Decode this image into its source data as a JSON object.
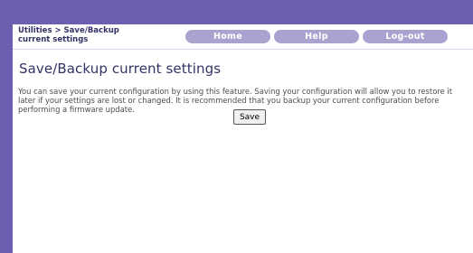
{
  "header": {
    "breadcrumb": "Utilities > Save/Backup current settings",
    "nav": {
      "home": "Home",
      "help": "Help",
      "logout": "Log-out"
    }
  },
  "main": {
    "title": "Save/Backup current settings",
    "description": "You can save your current configuration by using this feature. Saving your configuration will allow you to restore it later if your settings are lost or changed. It is recommended that you backup your current configuration before performing a firmware update.",
    "save_label": "Save"
  },
  "colors": {
    "frame": "#6a5fb0",
    "nav_button": "#a8a4cf",
    "title_text": "#333366"
  }
}
